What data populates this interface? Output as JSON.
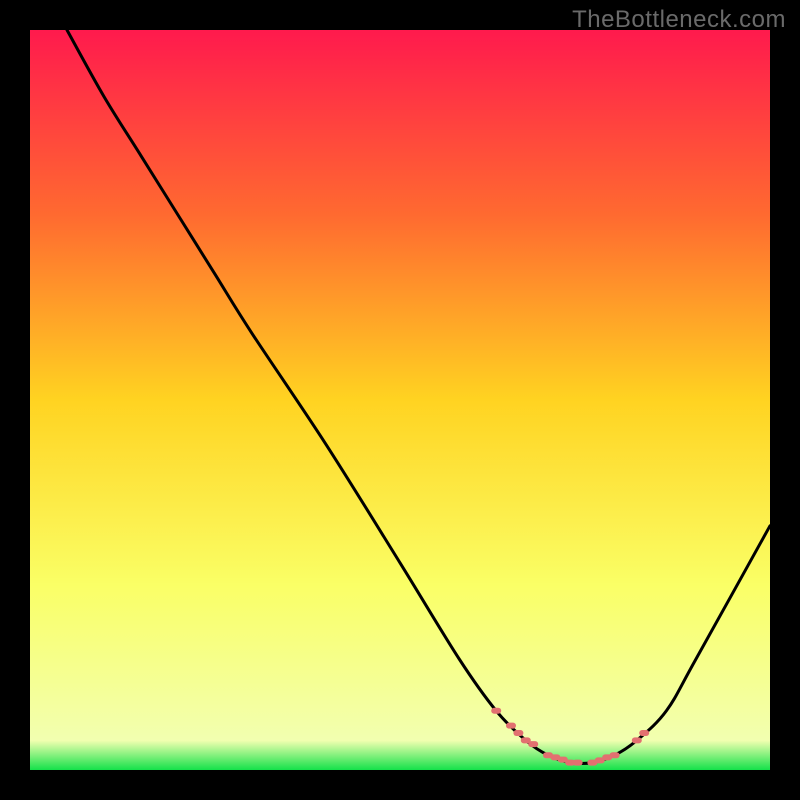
{
  "watermark": "TheBottleneck.com",
  "chart_data": {
    "type": "line",
    "title": "",
    "xlabel": "",
    "ylabel": "",
    "xlim": [
      0,
      100
    ],
    "ylim": [
      0,
      100
    ],
    "gradient_stops": [
      {
        "offset": 0.0,
        "color": "#ff1a4d"
      },
      {
        "offset": 0.25,
        "color": "#ff6a30"
      },
      {
        "offset": 0.5,
        "color": "#ffd321"
      },
      {
        "offset": 0.75,
        "color": "#faff66"
      },
      {
        "offset": 0.96,
        "color": "#f2ffb0"
      },
      {
        "offset": 1.0,
        "color": "#14e24a"
      }
    ],
    "series": [
      {
        "name": "bottleneck-curve",
        "x": [
          5,
          10,
          15,
          20,
          25,
          30,
          40,
          50,
          58,
          63,
          67,
          70,
          73,
          76,
          79,
          82,
          86,
          90,
          100
        ],
        "y": [
          100,
          91,
          83,
          75,
          67,
          59,
          44,
          28,
          15,
          8,
          4,
          2,
          1,
          1,
          2,
          4,
          8,
          15,
          33
        ]
      }
    ],
    "marker_points": {
      "name": "near-minimum",
      "color": "#e27070",
      "x": [
        63,
        65,
        66,
        67,
        68,
        70,
        71,
        72,
        73,
        74,
        76,
        77,
        78,
        79,
        82,
        83
      ],
      "y": [
        8,
        6,
        5,
        4,
        3.5,
        2,
        1.7,
        1.4,
        1,
        1,
        1,
        1.3,
        1.7,
        2,
        4,
        5
      ]
    }
  }
}
